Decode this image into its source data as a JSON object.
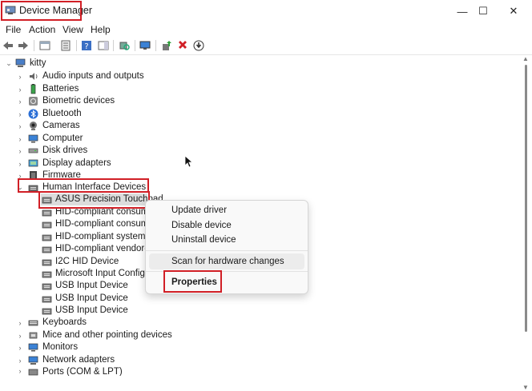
{
  "window": {
    "title": "Device Manager",
    "minimize": "—",
    "maximize": "☐",
    "close": "✕"
  },
  "menubar": {
    "file": "File",
    "action": "Action",
    "view": "View",
    "help": "Help"
  },
  "tree": {
    "root": "kitty",
    "categories": [
      {
        "label": "Audio inputs and outputs",
        "icon": "speaker-icon"
      },
      {
        "label": "Batteries",
        "icon": "battery-icon"
      },
      {
        "label": "Biometric devices",
        "icon": "fingerprint-icon"
      },
      {
        "label": "Bluetooth",
        "icon": "bluetooth-icon"
      },
      {
        "label": "Cameras",
        "icon": "camera-icon"
      },
      {
        "label": "Computer",
        "icon": "monitor-icon"
      },
      {
        "label": "Disk drives",
        "icon": "disk-icon"
      },
      {
        "label": "Display adapters",
        "icon": "display-adapter-icon"
      },
      {
        "label": "Firmware",
        "icon": "firmware-icon"
      },
      {
        "label": "Human Interface Devices",
        "icon": "hid-icon"
      }
    ],
    "hid_children": [
      "ASUS Precision Touchpad",
      "HID-compliant consumer",
      "HID-compliant consumer",
      "HID-compliant system co",
      "HID-compliant vendor-de",
      "I2C HID Device",
      "Microsoft Input Configur",
      "USB Input Device",
      "USB Input Device",
      "USB Input Device"
    ],
    "categories_after": [
      {
        "label": "Keyboards",
        "icon": "keyboard-icon"
      },
      {
        "label": "Mice and other pointing devices",
        "icon": "mouse-icon"
      },
      {
        "label": "Monitors",
        "icon": "monitor-icon"
      },
      {
        "label": "Network adapters",
        "icon": "network-icon"
      },
      {
        "label": "Ports (COM & LPT)",
        "icon": "port-icon"
      }
    ]
  },
  "context_menu": {
    "update": "Update driver",
    "disable": "Disable device",
    "uninstall": "Uninstall device",
    "scan": "Scan for hardware changes",
    "properties": "Properties"
  },
  "colors": {
    "highlight": "#d11f26",
    "selection": "#dcdcdc",
    "folder_blue": "#2f7fd0"
  }
}
